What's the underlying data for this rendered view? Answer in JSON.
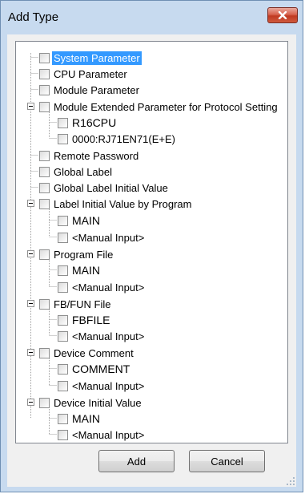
{
  "dialog": {
    "title": "Add Type"
  },
  "tree": [
    {
      "label": "System Parameter",
      "selected": true
    },
    {
      "label": "CPU Parameter"
    },
    {
      "label": "Module Parameter"
    },
    {
      "label": "Module Extended Parameter for Protocol Setting",
      "expanded": true
    },
    {
      "label": "R16CPU"
    },
    {
      "label": "0000:RJ71EN71(E+E)"
    },
    {
      "label": "Remote Password"
    },
    {
      "label": "Global Label"
    },
    {
      "label": "Global Label Initial Value"
    },
    {
      "label": "Label Initial Value by Program",
      "expanded": true
    },
    {
      "label": "MAIN"
    },
    {
      "label": "<Manual Input>"
    },
    {
      "label": "Program File",
      "expanded": true
    },
    {
      "label": "MAIN"
    },
    {
      "label": "<Manual Input>"
    },
    {
      "label": "FB/FUN File",
      "expanded": true
    },
    {
      "label": "FBFILE"
    },
    {
      "label": "<Manual Input>"
    },
    {
      "label": "Device Comment",
      "expanded": true
    },
    {
      "label": "COMMENT"
    },
    {
      "label": "<Manual Input>"
    },
    {
      "label": "Device Initial Value",
      "expanded": true
    },
    {
      "label": "MAIN"
    },
    {
      "label": "<Manual Input>"
    }
  ],
  "buttons": {
    "add": "Add",
    "cancel": "Cancel"
  }
}
